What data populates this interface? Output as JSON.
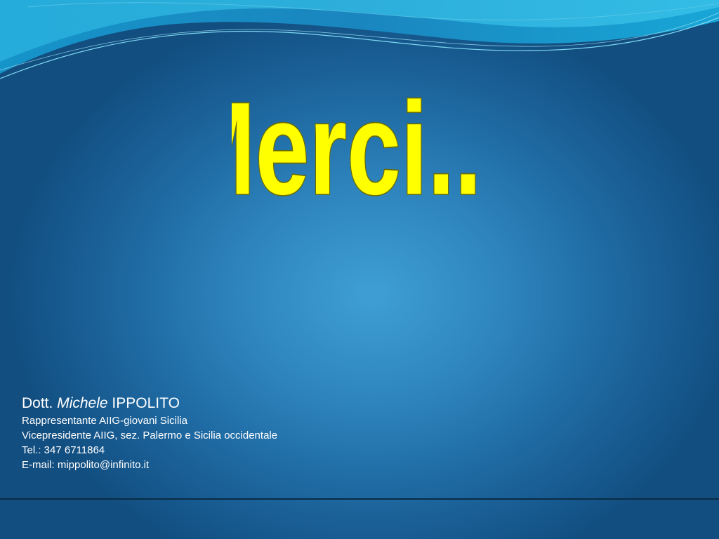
{
  "slide": {
    "title": "Merci...!",
    "title_color": "#ffff00",
    "title_outline_color": "#5a5a00",
    "background_center": "#3f9fd4",
    "background_edge": "#124e80",
    "wave_colors": [
      "#1a9fcf",
      "#2db6e0",
      "#5fd0ee"
    ]
  },
  "contact": {
    "prefix": "Dott.",
    "first_name": "Michele",
    "last_name": "IPPOLITO",
    "role": "Rappresentante AIIG-giovani Sicilia",
    "position": "Vicepresidente AIIG, sez. Palermo e Sicilia occidentale",
    "phone": "Tel.: 347 6711864",
    "email": "E-mail: mippolito@infinito.it"
  }
}
